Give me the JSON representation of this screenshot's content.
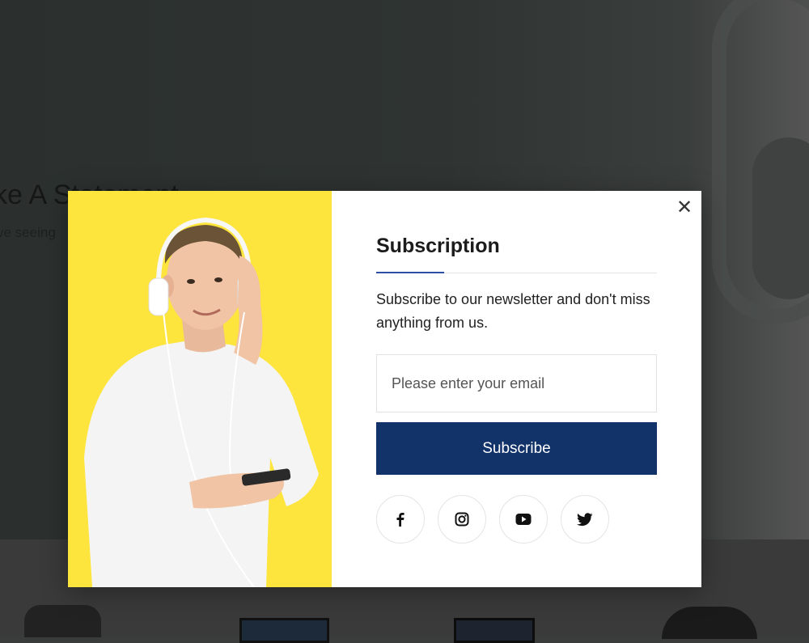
{
  "background": {
    "hero_title": "ke A Statement",
    "hero_subtitle": "ve seeing"
  },
  "modal": {
    "title": "Subscription",
    "description": "Subscribe to our newsletter and don't miss anything from us.",
    "email_placeholder": "Please enter your email",
    "subscribe_label": "Subscribe",
    "close_icon": "close-icon",
    "image_icon": "man-with-headphones-photo",
    "social": [
      "facebook-icon",
      "instagram-icon",
      "youtube-icon",
      "twitter-icon"
    ],
    "colors": {
      "image_bg": "#fde53d",
      "button_bg": "#12336a",
      "accent_line": "#2a4fa3"
    }
  }
}
